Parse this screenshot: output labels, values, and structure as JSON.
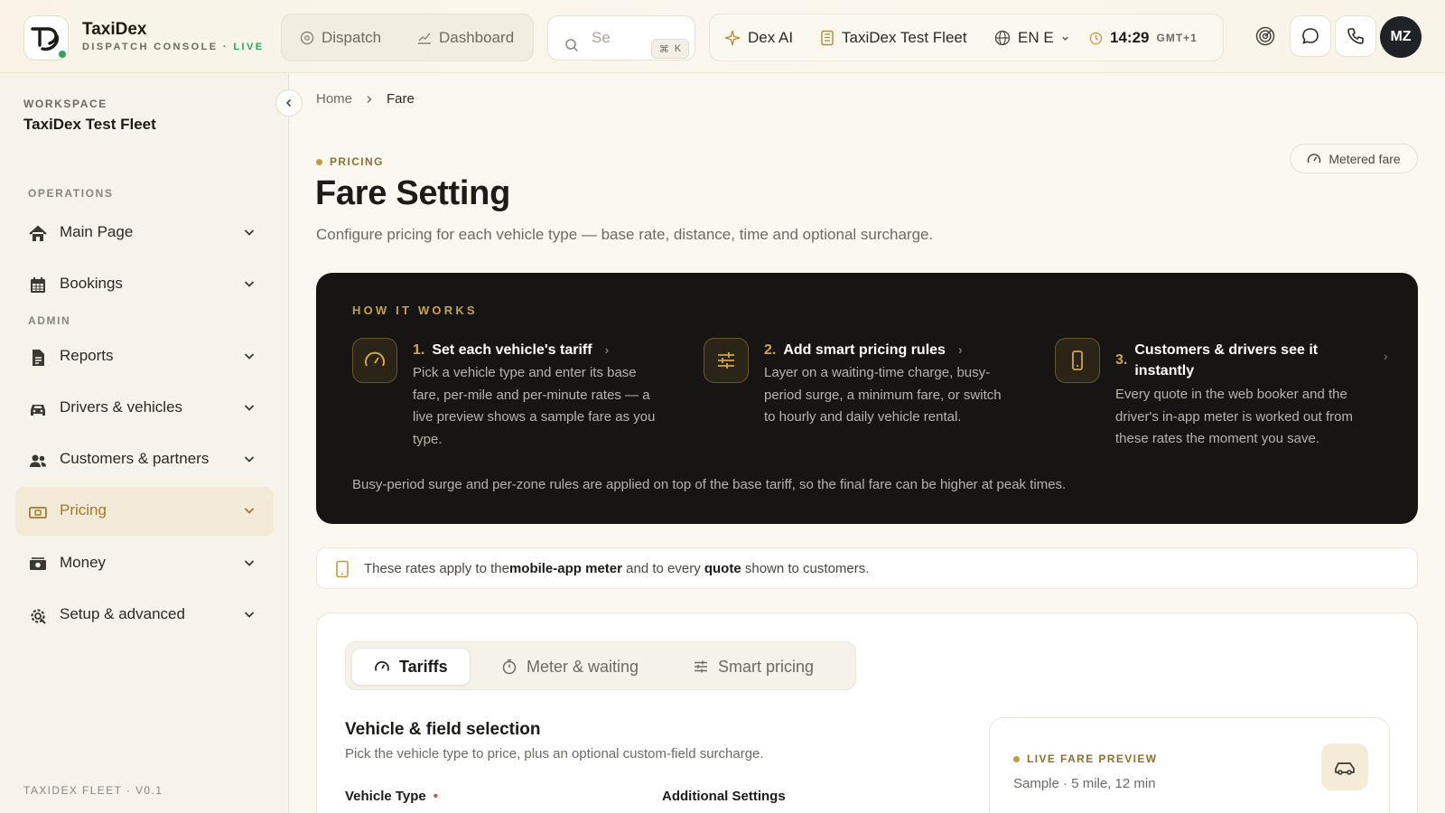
{
  "header": {
    "brand_title": "TaxiDex",
    "brand_sub": "DISPATCH CONSOLE · ",
    "brand_live": "LIVE",
    "nav": {
      "dispatch": "Dispatch",
      "dashboard": "Dashboard"
    },
    "search": {
      "placeholder": "Se",
      "shortcut_mod": "⌘",
      "shortcut_key": "K"
    },
    "status": {
      "ai": "Dex AI",
      "fleet": "TaxiDex Test Fleet",
      "language": "EN E",
      "time": "14:29",
      "timezone": "GMT+1"
    },
    "avatar_initials": "MZ"
  },
  "sidebar": {
    "workspace_label": "WORKSPACE",
    "workspace_name": "TaxiDex Test Fleet",
    "operations_label": "OPERATIONS",
    "admin_label": "ADMIN",
    "items": [
      {
        "label": "Main Page",
        "icon": "home-icon"
      },
      {
        "label": "Bookings",
        "icon": "calendar-icon"
      },
      {
        "label": "Reports",
        "icon": "document-icon"
      },
      {
        "label": "Drivers & vehicles",
        "icon": "car-icon"
      },
      {
        "label": "Customers & partners",
        "icon": "users-icon"
      },
      {
        "label": "Pricing",
        "icon": "money-tag-icon",
        "active": true
      },
      {
        "label": "Money",
        "icon": "cash-icon"
      },
      {
        "label": "Setup & advanced",
        "icon": "gear-icon"
      }
    ],
    "footer": "TAXIDEX FLEET · V0.1"
  },
  "breadcrumb": {
    "home": "Home",
    "current": "Fare"
  },
  "page": {
    "eyebrow": "PRICING",
    "title": "Fare Setting",
    "description": "Configure pricing for each vehicle type — base rate, distance, time and optional surcharge.",
    "metered_pill": "Metered fare"
  },
  "how_it_works": {
    "title": "HOW IT WORKS",
    "steps": [
      {
        "num": "1.",
        "title": "Set each vehicle's tariff",
        "body": "Pick a vehicle type and enter its base fare, per-mile and per-minute rates — a live preview shows a sample fare as you type."
      },
      {
        "num": "2.",
        "title": "Add smart pricing rules",
        "body": "Layer on a waiting-time charge, busy-period surge, a minimum fare, or switch to hourly and daily vehicle rental."
      },
      {
        "num": "3.",
        "title": "Customers & drivers see it instantly",
        "body": "Every quote in the web booker and the driver's in-app meter is worked out from these rates the moment you save."
      }
    ],
    "footer": "Busy-period surge and per-zone rules are applied on top of the base tariff, so the final fare can be higher at peak times."
  },
  "note": {
    "prefix": "These rates apply to the ",
    "bold1": "mobile-app meter",
    "middle": " and to every ",
    "bold2": "quote",
    "suffix": " shown to customers."
  },
  "tabs": [
    {
      "label": "Tariffs",
      "active": true
    },
    {
      "label": "Meter & waiting"
    },
    {
      "label": "Smart pricing"
    }
  ],
  "vehicle_section": {
    "title": "Vehicle & field selection",
    "description": "Pick the vehicle type to price, plus an optional custom-field surcharge.",
    "vehicle_type_label": "Vehicle Type",
    "required_mark": "•",
    "additional_label": "Additional Settings"
  },
  "preview": {
    "label": "LIVE FARE PREVIEW",
    "sample": "Sample · 5 mile, 12 min"
  },
  "colors": {
    "accent": "#c49a3c",
    "live": "#2aa55d",
    "dark_card": "#161514"
  }
}
